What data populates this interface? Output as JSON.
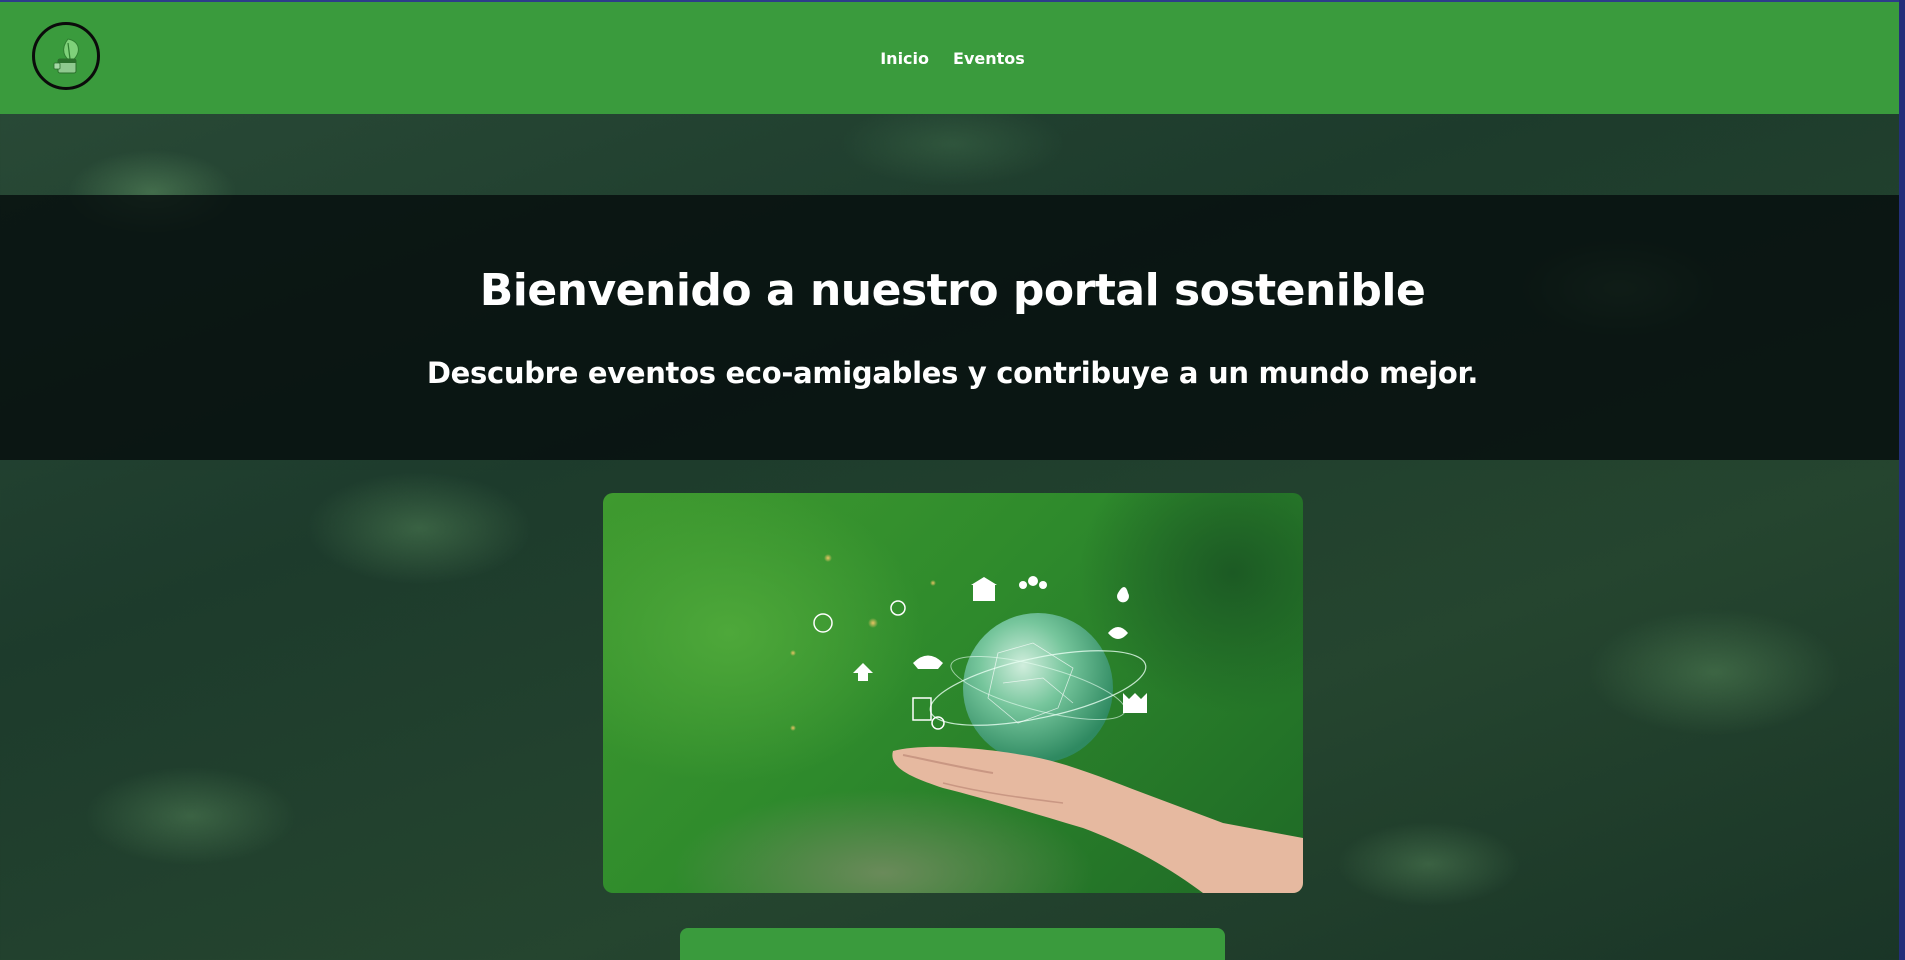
{
  "header": {
    "logo_icon": "leaf-calendar-icon",
    "nav": [
      {
        "label": "Inicio"
      },
      {
        "label": "Eventos"
      }
    ]
  },
  "hero": {
    "title": "Bienvenido a nuestro portal sostenible",
    "subtitle": "Descubre eventos eco-amigables y contribuye a un mundo mejor.",
    "image_icon": "globe-in-hand-eco-icons"
  },
  "colors": {
    "header": "#3a9b3d",
    "hero_band": "#060e0e",
    "text": "#ffffff"
  }
}
